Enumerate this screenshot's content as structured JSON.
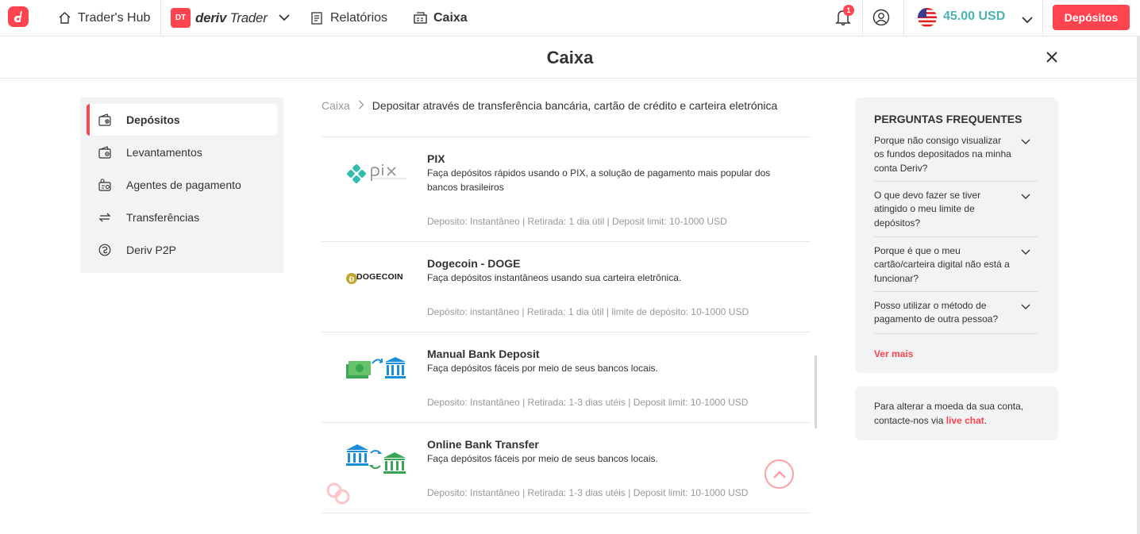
{
  "header": {
    "traders_hub": "Trader's Hub",
    "app_badge": "DT",
    "app_brand_bold": "deriv",
    "app_brand_rest": " Trader",
    "reports": "Relatórios",
    "cashier": "Caixa",
    "notification_count": "1",
    "balance": "45.00 USD",
    "deposit_button": "Depósitos"
  },
  "page": {
    "title": "Caixa"
  },
  "sidebar": {
    "items": [
      {
        "label": "Depósitos",
        "icon": "wallet-deposit-icon",
        "active": true
      },
      {
        "label": "Levantamentos",
        "icon": "wallet-withdraw-icon",
        "active": false
      },
      {
        "label": "Agentes de pagamento",
        "icon": "payment-agent-icon",
        "active": false
      },
      {
        "label": "Transferências",
        "icon": "transfer-arrows-icon",
        "active": false
      },
      {
        "label": "Deriv P2P",
        "icon": "p2p-icon",
        "active": false
      }
    ]
  },
  "breadcrumb": {
    "root": "Caixa",
    "current": "Depositar através de transferência bancária, cartão de crédito e carteira eletrónica"
  },
  "methods": [
    {
      "title": "PIX",
      "logo": "pix-logo",
      "description": "Faça depósitos rápidos usando o PIX, a solução de pagamento mais popular dos bancos brasileiros",
      "meta": "Deposito: Instantâneo | Retirada: 1 dia útil | Deposit limit: 10-1000 USD"
    },
    {
      "title": "Dogecoin - DOGE",
      "logo": "dogecoin-logo",
      "logo_text": "DOGECOIN",
      "description": "Faça depósitos instantâneos usando sua carteira eletrônica.",
      "meta": "Depósito: instantâneo | Retirada: 1 dia útil | limite de depósito: 10-1000 USD"
    },
    {
      "title": "Manual Bank Deposit",
      "logo": "cash-to-bank-icon",
      "description": "Faça depósitos fáceis por meio de seus bancos locais.",
      "meta": "Deposito: Instantâneo | Retirada: 1-3 dias utéis | Deposit limit: 10-1000 USD"
    },
    {
      "title": "Online Bank Transfer",
      "logo": "bank-to-bank-icon",
      "description": "Faça depósitos fáceis por meio de seus bancos locais.",
      "meta": "Deposito: Instantâneo | Retirada: 1-3 dias utéis | Deposit limit: 10-1000 USD"
    }
  ],
  "faq": {
    "title": "PERGUNTAS FREQUENTES",
    "questions": [
      "Porque não consigo visualizar os fundos depositados na minha conta Deriv?",
      "O que devo fazer se tiver atingido o meu limite de depósitos?",
      "Porque é que o meu cartão/carteira digital não está a funcionar?",
      "Posso utilizar o método de pagamento de outra pessoa?"
    ],
    "more": "Ver mais"
  },
  "note": {
    "text_before": "Para alterar a moeda da sua conta, contacte-nos via ",
    "link": "live chat",
    "text_after": "."
  },
  "colors": {
    "accent": "#ff444f",
    "balance": "#4bb4b3",
    "panel": "#f2f3f4"
  }
}
